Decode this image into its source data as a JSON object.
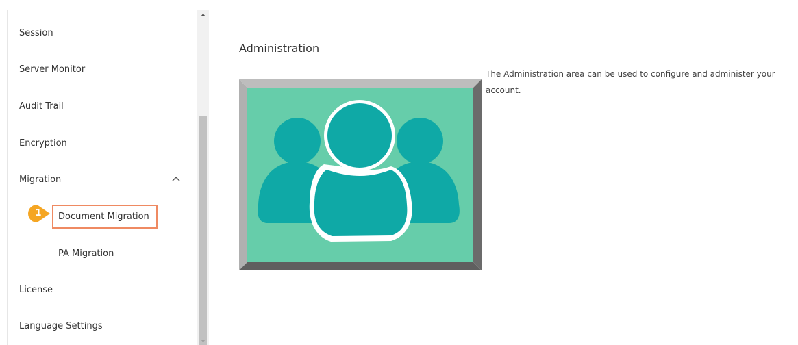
{
  "sidebar": {
    "items": [
      {
        "label": "Session"
      },
      {
        "label": "Server Monitor"
      },
      {
        "label": "Audit Trail"
      },
      {
        "label": "Encryption"
      },
      {
        "label": "Migration"
      },
      {
        "label": "Document Migration"
      },
      {
        "label": "PA Migration"
      },
      {
        "label": "License"
      },
      {
        "label": "Language Settings"
      }
    ]
  },
  "callout": {
    "step": "1",
    "color": "#f5a623",
    "box_color": "#ef8a62"
  },
  "main": {
    "title": "Administration",
    "description": "The Administration area can be used to configure and administer your account."
  },
  "icons": {
    "migration_toggle": "chevron-up-icon",
    "hero": "users-group-icon"
  },
  "colors": {
    "hero_bg": "#66cdaa",
    "hero_people": "#0fa9a6",
    "frame_light": "#bdbdbd",
    "frame_dark": "#6b6b6b"
  }
}
